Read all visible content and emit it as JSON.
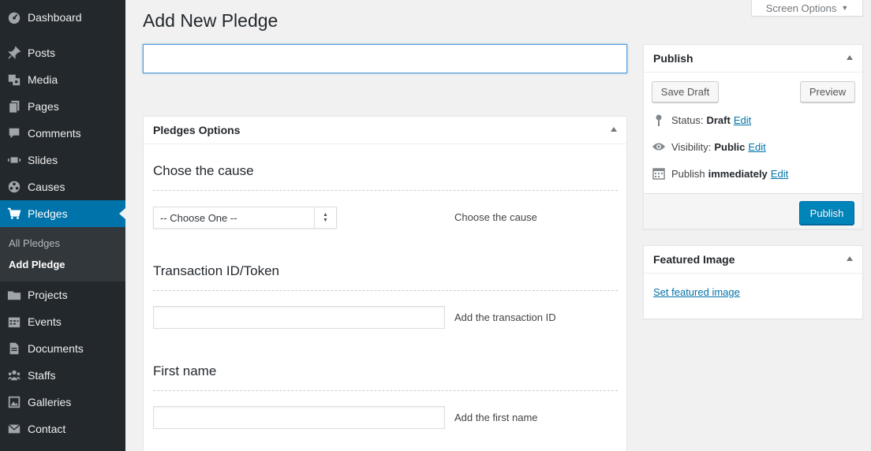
{
  "sidebar": {
    "items": [
      {
        "label": "Dashboard",
        "icon": "dashboard-icon"
      },
      {
        "label": "Posts",
        "icon": "pin-icon"
      },
      {
        "label": "Media",
        "icon": "media-icon"
      },
      {
        "label": "Pages",
        "icon": "pages-icon"
      },
      {
        "label": "Comments",
        "icon": "comment-icon"
      },
      {
        "label": "Slides",
        "icon": "slides-icon"
      },
      {
        "label": "Causes",
        "icon": "causes-icon"
      },
      {
        "label": "Pledges",
        "icon": "cart-icon"
      },
      {
        "label": "Projects",
        "icon": "folder-icon"
      },
      {
        "label": "Events",
        "icon": "calendar-icon"
      },
      {
        "label": "Documents",
        "icon": "document-icon"
      },
      {
        "label": "Staffs",
        "icon": "users-icon"
      },
      {
        "label": "Galleries",
        "icon": "gallery-icon"
      },
      {
        "label": "Contact",
        "icon": "mail-icon"
      }
    ],
    "submenu": [
      {
        "label": "All Pledges"
      },
      {
        "label": "Add Pledge"
      }
    ]
  },
  "header": {
    "title": "Add New Pledge",
    "screen_options": "Screen Options"
  },
  "title_input": {
    "value": ""
  },
  "pledges_box": {
    "title": "Pledges Options",
    "fields": [
      {
        "title": "Chose the cause",
        "select_value": "-- Choose One --",
        "description": "Choose the cause"
      },
      {
        "title": "Transaction ID/Token",
        "value": "",
        "description": "Add the transaction ID"
      },
      {
        "title": "First name",
        "value": "",
        "description": "Add the first name"
      }
    ]
  },
  "publish_box": {
    "title": "Publish",
    "save_draft": "Save Draft",
    "preview": "Preview",
    "status_label": "Status:",
    "status_value": "Draft",
    "visibility_label": "Visibility:",
    "visibility_value": "Public",
    "publish_label": "Publish",
    "publish_value": "immediately",
    "edit": "Edit",
    "publish_button": "Publish"
  },
  "featured_box": {
    "title": "Featured Image",
    "link": "Set featured image"
  },
  "colors": {
    "sidebar_bg": "#23282d",
    "active": "#0073aa",
    "primary_button": "#0085ba",
    "link": "#0073aa"
  }
}
